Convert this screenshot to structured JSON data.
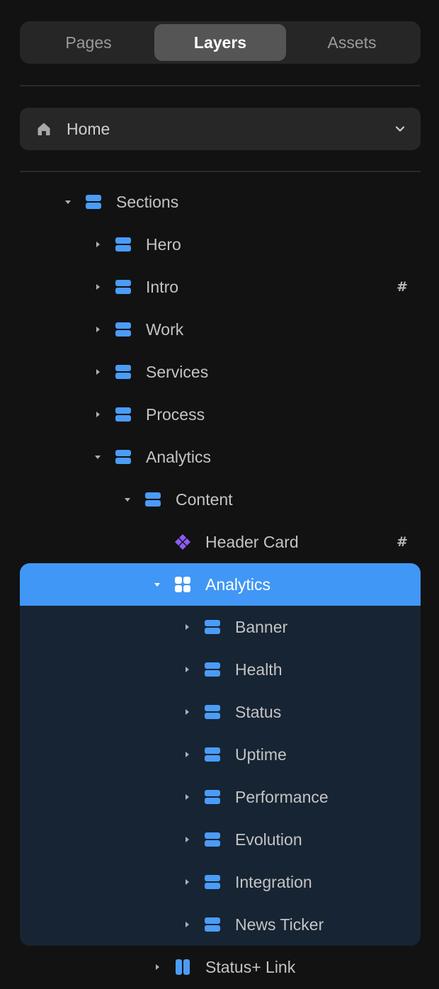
{
  "tabs": [
    {
      "label": "Pages",
      "active": false
    },
    {
      "label": "Layers",
      "active": true
    },
    {
      "label": "Assets",
      "active": false
    }
  ],
  "page_select": {
    "icon": "home-icon",
    "value": "Home",
    "dropdown_icon": "chevron-down-icon"
  },
  "colors": {
    "background": "#121212",
    "selection": "#4197f5",
    "selection_children_bg": "#172433",
    "frame_icon": "#4a9cf7",
    "component_icon": "#8b5cf6"
  },
  "tree": [
    {
      "label": "Sections",
      "depth": 0,
      "expander": "expanded",
      "icon": "stack-icon"
    },
    {
      "label": "Hero",
      "depth": 1,
      "expander": "collapsed",
      "icon": "stack-icon"
    },
    {
      "label": "Intro",
      "depth": 1,
      "expander": "collapsed",
      "icon": "stack-icon",
      "trailing": "#"
    },
    {
      "label": "Work",
      "depth": 1,
      "expander": "collapsed",
      "icon": "stack-icon"
    },
    {
      "label": "Services",
      "depth": 1,
      "expander": "collapsed",
      "icon": "stack-icon"
    },
    {
      "label": "Process",
      "depth": 1,
      "expander": "collapsed",
      "icon": "stack-icon"
    },
    {
      "label": "Analytics",
      "depth": 1,
      "expander": "expanded",
      "icon": "stack-icon"
    },
    {
      "label": "Content",
      "depth": 2,
      "expander": "expanded",
      "icon": "stack-icon"
    },
    {
      "label": "Header Card",
      "depth": 3,
      "expander": "none",
      "icon": "component-icon",
      "trailing": "#"
    },
    {
      "label": "Analytics",
      "depth": 3,
      "expander": "expanded",
      "icon": "grid-icon",
      "selected": true
    },
    {
      "label": "Banner",
      "depth": 4,
      "expander": "collapsed",
      "icon": "stack-icon"
    },
    {
      "label": "Health",
      "depth": 4,
      "expander": "collapsed",
      "icon": "stack-icon"
    },
    {
      "label": "Status",
      "depth": 4,
      "expander": "collapsed",
      "icon": "stack-icon"
    },
    {
      "label": "Uptime",
      "depth": 4,
      "expander": "collapsed",
      "icon": "stack-icon"
    },
    {
      "label": "Performance",
      "depth": 4,
      "expander": "collapsed",
      "icon": "stack-icon"
    },
    {
      "label": "Evolution",
      "depth": 4,
      "expander": "collapsed",
      "icon": "stack-icon"
    },
    {
      "label": "Integration",
      "depth": 4,
      "expander": "collapsed",
      "icon": "stack-icon"
    },
    {
      "label": "News Ticker",
      "depth": 4,
      "expander": "collapsed",
      "icon": "stack-icon"
    },
    {
      "label": "Status+ Link",
      "depth": 3,
      "expander": "collapsed",
      "icon": "columns-icon"
    }
  ]
}
